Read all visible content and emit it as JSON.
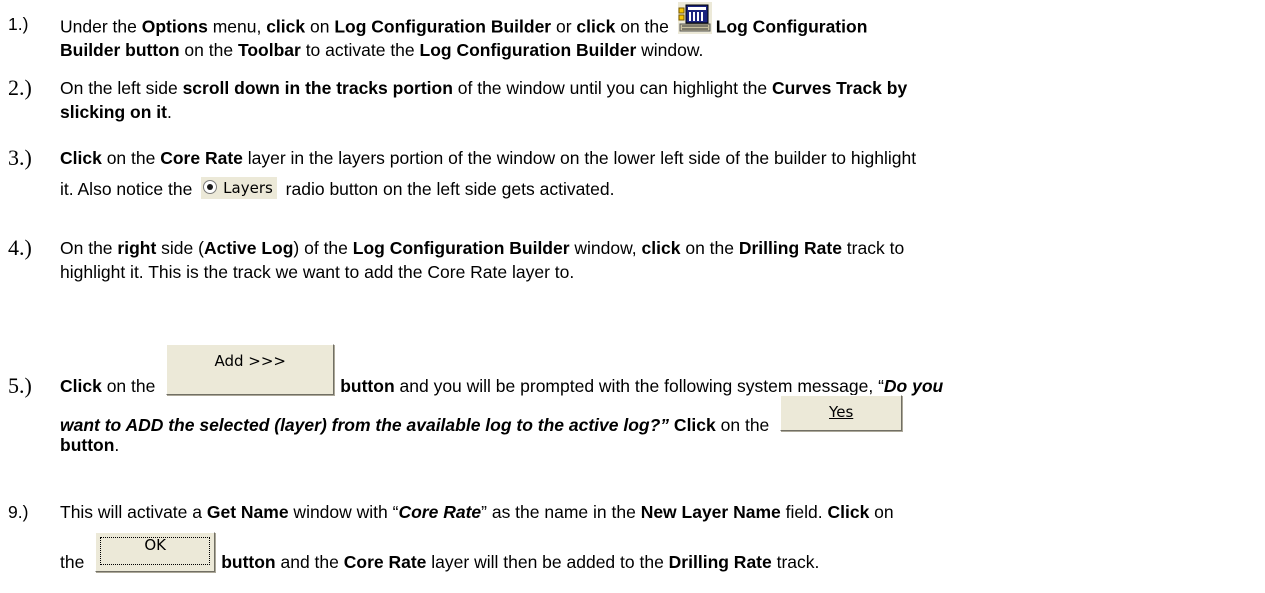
{
  "steps": [
    {
      "number": "1.)",
      "segments": [
        {
          "t": "Under the ",
          "b": false
        },
        {
          "t": "Options",
          "b": true
        },
        {
          "t": " menu, ",
          "b": false
        },
        {
          "t": "click",
          "b": true
        },
        {
          "t": " on ",
          "b": false
        },
        {
          "t": "Log Configuration Builder",
          "b": true
        },
        {
          "t": " or ",
          "b": false
        },
        {
          "t": "click",
          "b": true
        },
        {
          "t": " on the ",
          "b": false
        }
      ],
      "segments_after_icon": [
        {
          "t": "Log Configuration",
          "b": true
        }
      ],
      "line2": [
        {
          "t": "Builder button",
          "b": true
        },
        {
          "t": " on the ",
          "b": false
        },
        {
          "t": "Toolbar",
          "b": true
        },
        {
          "t": " to activate the ",
          "b": false
        },
        {
          "t": "Log Configuration Builder",
          "b": true
        },
        {
          "t": " window.",
          "b": false
        }
      ]
    },
    {
      "number": "2.)",
      "line1": [
        {
          "t": "On the left side ",
          "b": false
        },
        {
          "t": "scroll down in the tracks portion",
          "b": true
        },
        {
          "t": " of the window until you can highlight the ",
          "b": false
        },
        {
          "t": "Curves Track by",
          "b": true
        }
      ],
      "line2": [
        {
          "t": "slicking on it",
          "b": true
        },
        {
          "t": ".",
          "b": false
        }
      ]
    },
    {
      "number": "3.)",
      "line1": [
        {
          "t": "Click",
          "b": true
        },
        {
          "t": " on the ",
          "b": false
        },
        {
          "t": "Core Rate",
          "b": true
        },
        {
          "t": " layer in the layers portion of the window on the lower left side of the builder to highlight",
          "b": false
        }
      ],
      "line2_before": "it. Also notice the ",
      "radio_label": "Layers",
      "line2_after": " radio button on the left side gets activated."
    },
    {
      "number": "4.)",
      "line1": [
        {
          "t": "On the ",
          "b": false
        },
        {
          "t": "right",
          "b": true
        },
        {
          "t": " side (",
          "b": false
        },
        {
          "t": "Active Log",
          "b": true
        },
        {
          "t": ") of the ",
          "b": false
        },
        {
          "t": "Log Configuration Builder",
          "b": true
        },
        {
          "t": " window, ",
          "b": false
        },
        {
          "t": "click",
          "b": true
        },
        {
          "t": " on the ",
          "b": false
        },
        {
          "t": "Drilling Rate",
          "b": true
        },
        {
          "t": " track to",
          "b": false
        }
      ],
      "line2": [
        {
          "t": "highlight it. This is the track we want to add the Core Rate layer to.",
          "b": false
        }
      ]
    },
    {
      "number": "5.)",
      "click": "Click",
      "on_the": " on the ",
      "add_button_label": "Add >>>",
      "after_add_1": "button",
      "after_add_2": " and you will be prompted with the following system message, “",
      "msg_start": "Do you",
      "msg_rest": "want to ADD the selected (layer) from the available log to the active log?”",
      "click2": " Click",
      "on_the2": " on the ",
      "yes_button_label": "Yes",
      "button_word": "button",
      "period": "."
    },
    {
      "number": "9.)",
      "l1_a": "This will activate a ",
      "l1_b": "Get Name",
      "l1_c": " window with “",
      "l1_d": "Core Rate",
      "l1_e": "” as the name in the ",
      "l1_f": "New Layer Name",
      "l1_g": " field. ",
      "l1_h": "Click",
      "l1_i": " on",
      "l2_a": "the ",
      "ok_button_label": "OK",
      "l2_b": "button",
      "l2_c": " and the ",
      "l2_d": "Core Rate",
      "l2_e": " layer will then be added to the ",
      "l2_f": "Drilling Rate",
      "l2_g": " track."
    }
  ],
  "icons": {
    "toolbar_icon": "log-configuration-builder-icon",
    "radio_icon": "radio-selected-icon"
  }
}
